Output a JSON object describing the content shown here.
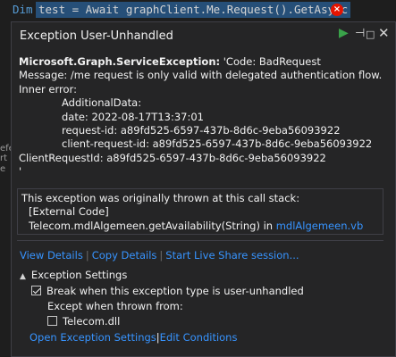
{
  "editor": {
    "keyword": "Dim",
    "code": "test = Await graphClient.Me.Request().GetAsync",
    "gutter_fragments": [
      "efe",
      "rt",
      "e"
    ],
    "error_badge": "×"
  },
  "popup": {
    "title": "Exception User-Unhandled",
    "controls": {
      "continue": "▶",
      "pin": "⊣",
      "restore": "□",
      "close": "✕"
    },
    "exception_type": "Microsoft.Graph.ServiceException:",
    "exception_code": " 'Code: BadRequest",
    "message_line": "Message: /me request is only valid with delegated authentication flow.",
    "inner_error": "Inner error:",
    "additional_data": "AdditionalData:",
    "date": "date: 2022-08-17T13:37:01",
    "request_id": "request-id: a89fd525-6597-437b-8d6c-9eba56093922",
    "client_request_id": "client-request-id: a89fd525-6597-437b-8d6c-9eba56093922",
    "client_request_id_main": "ClientRequestId: a89fd525-6597-437b-8d6c-9eba56093922",
    "trailing": "'",
    "callstack": {
      "header": "This exception was originally thrown at this call stack:",
      "external": "[External Code]",
      "frame": "Telecom.mdlAlgemeen.getAvailability(String) in ",
      "frame_link": "mdlAlgemeen.vb"
    },
    "actions": {
      "view_details": "View Details",
      "copy_details": "Copy Details",
      "live_share": "Start Live Share session...",
      "divider": "|"
    },
    "settings": {
      "arrow": "▲",
      "header": "Exception Settings",
      "break_label": "Break when this exception type is user-unhandled",
      "except_label": "Except when thrown from:",
      "module_label": "Telecom.dll",
      "open_settings": "Open Exception Settings",
      "edit_conditions": "Edit Conditions"
    }
  }
}
